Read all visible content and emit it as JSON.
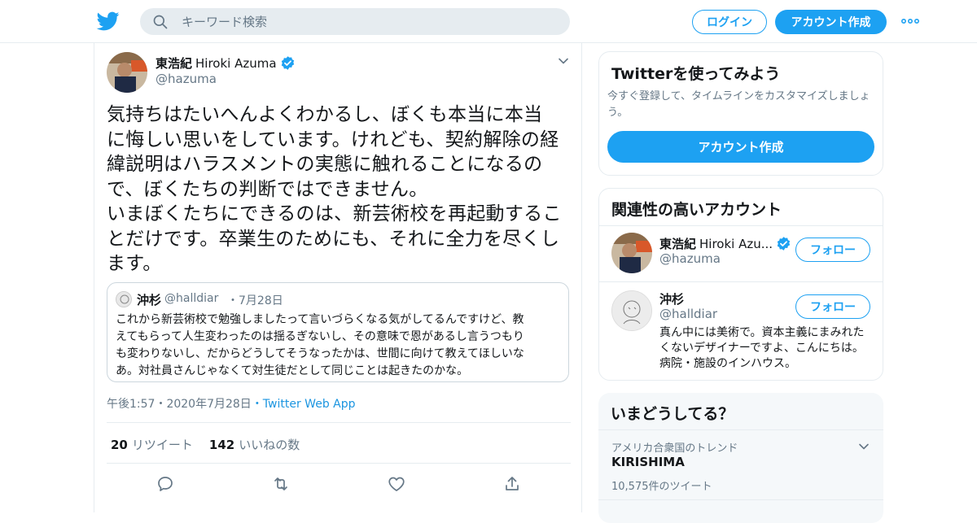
{
  "header": {
    "search_placeholder": "キーワード検索",
    "login_label": "ログイン",
    "signup_label": "アカウント作成",
    "accent_color": "#1da1f2"
  },
  "tweet": {
    "author_name": "東浩紀",
    "author_name_en": "Hiroki Azuma",
    "author_handle": "@hazuma",
    "text": "気持ちはたいへんよくわかるし、ぼくも本当に本当\nに悔しい思いをしています。けれども、契約解除の経\n緯説明はハラスメントの実態に触れることになるの\nで、ぼくたちの判断ではできません。\nいまぼくたちにできるのは、新芸術校を再起動するこ\nとだけです。卒業生のためにも、それに全力を尽くし\nます。",
    "quote": {
      "name": "沖杉",
      "handle": "@halldiar",
      "date": "・7月28日",
      "text": "これから新芸術校で勉強しましたって言いづらくなる気がしてるんですけど、教\nえてもらって人生変わったのは揺るぎないし、その意味で恩があるし言うつもり\nも変わりないし、だからどうしてそうなったかは、世間に向けて教えてほしいな\nあ。対社員さんじゃなくて対生徒だとして同じことは起きたのかな。"
    },
    "time": "午後1:57",
    "date": "・2020年7月28日",
    "via": "・Twitter Web App",
    "retweets": "20",
    "retweets_label": "リツイート",
    "likes": "142",
    "likes_label": "いいねの数"
  },
  "sidebar": {
    "try_title": "Twitterを使ってみよう",
    "try_desc": "今すぐ登録して、タイムラインをカスタマイズしましょう。",
    "try_button": "アカウント作成",
    "related_title": "関連性の高いアカウント",
    "accounts": [
      {
        "name": "東浩紀",
        "name_en": "Hiroki Azu...",
        "handle": "@hazuma",
        "follow_label": "フォロー"
      },
      {
        "name": "沖杉",
        "handle": "@halldiar",
        "follow_label": "フォロー",
        "bio": "真ん中には美術で。資本主義にまみれたくないデザイナーですよ、こんにちは。病院・施設のインハウス。"
      }
    ],
    "trends_title": "いまどうしてる？",
    "trend": {
      "context": "アメリカ合衆国のトレンド",
      "name": "KIRISHIMA",
      "count": "10,575件のツイート"
    }
  }
}
